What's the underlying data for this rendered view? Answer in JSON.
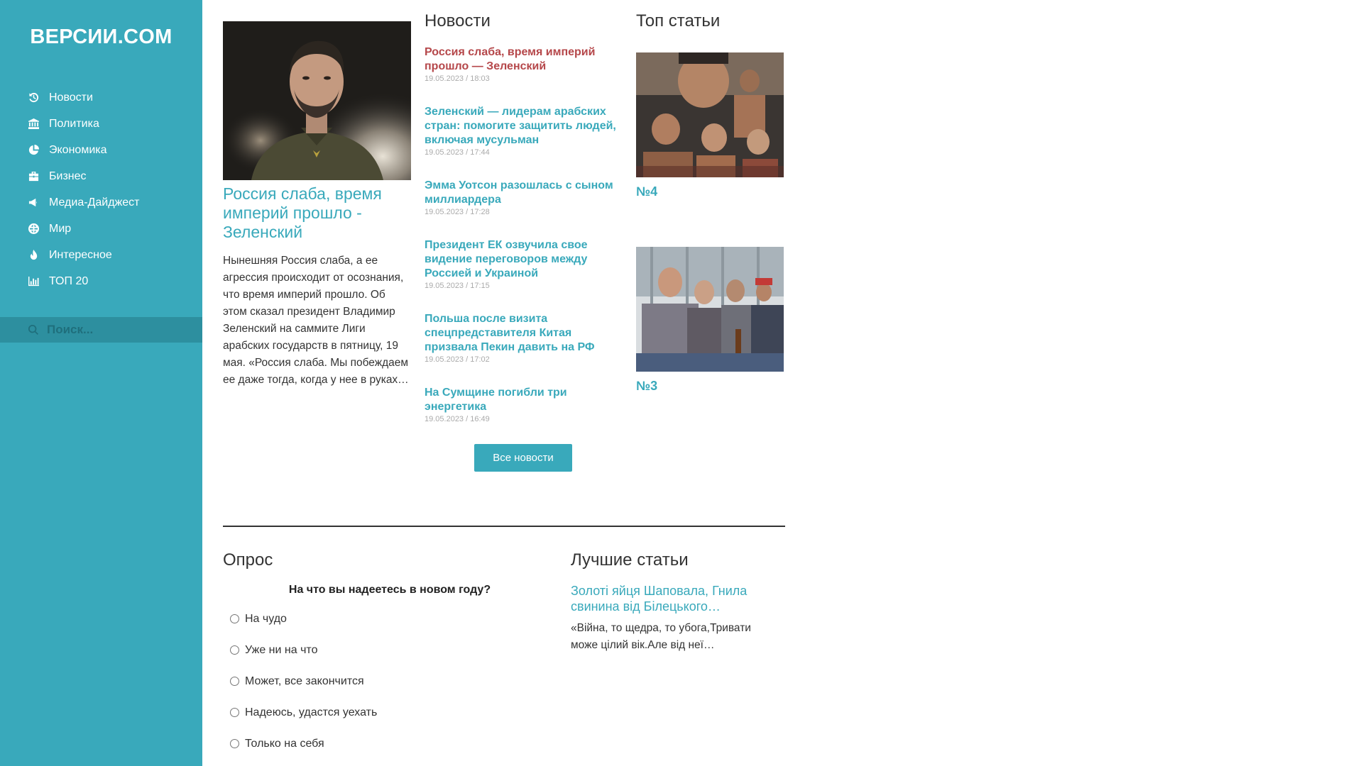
{
  "site": {
    "logo": "ВЕРСИИ.COM"
  },
  "sidebar": {
    "items": [
      {
        "label": "Новости",
        "icon": "history-icon"
      },
      {
        "label": "Политика",
        "icon": "bank-icon"
      },
      {
        "label": "Экономика",
        "icon": "pie-chart-icon"
      },
      {
        "label": "Бизнес",
        "icon": "briefcase-icon"
      },
      {
        "label": "Медиа-Дайджест",
        "icon": "megaphone-icon"
      },
      {
        "label": "Мир",
        "icon": "globe-icon"
      },
      {
        "label": "Интересное",
        "icon": "fire-icon"
      },
      {
        "label": "ТОП 20",
        "icon": "bar-chart-icon"
      }
    ],
    "search_placeholder": "Поиск..."
  },
  "featured": {
    "title": "Россия слаба, время империй прошло - Зеленский",
    "text": "Нынешняя Россия слаба, а ее агрессия происходит от осознания, что время империй прошло. Об этом сказал президент Владимир Зеленский на саммите Лиги арабских государств в пятницу, 19 мая. «Россия слаба. Мы побеждаем ее даже тогда, когда у нее в руках…"
  },
  "news": {
    "heading": "Новости",
    "items": [
      {
        "title": "Россия слаба, время империй прошло — Зеленский",
        "date": "19.05.2023 / 18:03"
      },
      {
        "title": "Зеленский — лидерам арабских стран: помогите защитить людей, включая мусульман",
        "date": "19.05.2023 / 17:44"
      },
      {
        "title": "Эмма Уотсон разошлась с сыном миллиардера",
        "date": "19.05.2023 / 17:28"
      },
      {
        "title": "Президент ЕК озвучила свое видение переговоров между Россией и Украиной",
        "date": "19.05.2023 / 17:15"
      },
      {
        "title": "Польша после визита спецпредставителя Китая призвала Пекин давить на РФ",
        "date": "19.05.2023 / 17:02"
      },
      {
        "title": "На Сумщине погибли три энергетика",
        "date": "19.05.2023 / 16:49"
      }
    ],
    "all_button": "Все новости"
  },
  "top": {
    "heading": "Топ статьи",
    "items": [
      {
        "caption": "№4"
      },
      {
        "caption": "№3"
      }
    ]
  },
  "poll": {
    "heading": "Опрос",
    "question": "На что вы надеетесь в новом году?",
    "options": [
      "На чудо",
      "Уже ни на что",
      "Может, все закончится",
      "Надеюсь, удастся уехать",
      "Только на себя"
    ]
  },
  "best": {
    "heading": "Лучшие статьи",
    "title": "Золоті яйця Шаповала, Гнила свинина від Білецького…",
    "text": "«Війна, то щедра, то убога,Тривати може цілий вік.Але від неї…"
  },
  "colors": {
    "accent": "#39a9bb",
    "active_link": "#b5474a",
    "search_bg": "#2d8f9f"
  }
}
